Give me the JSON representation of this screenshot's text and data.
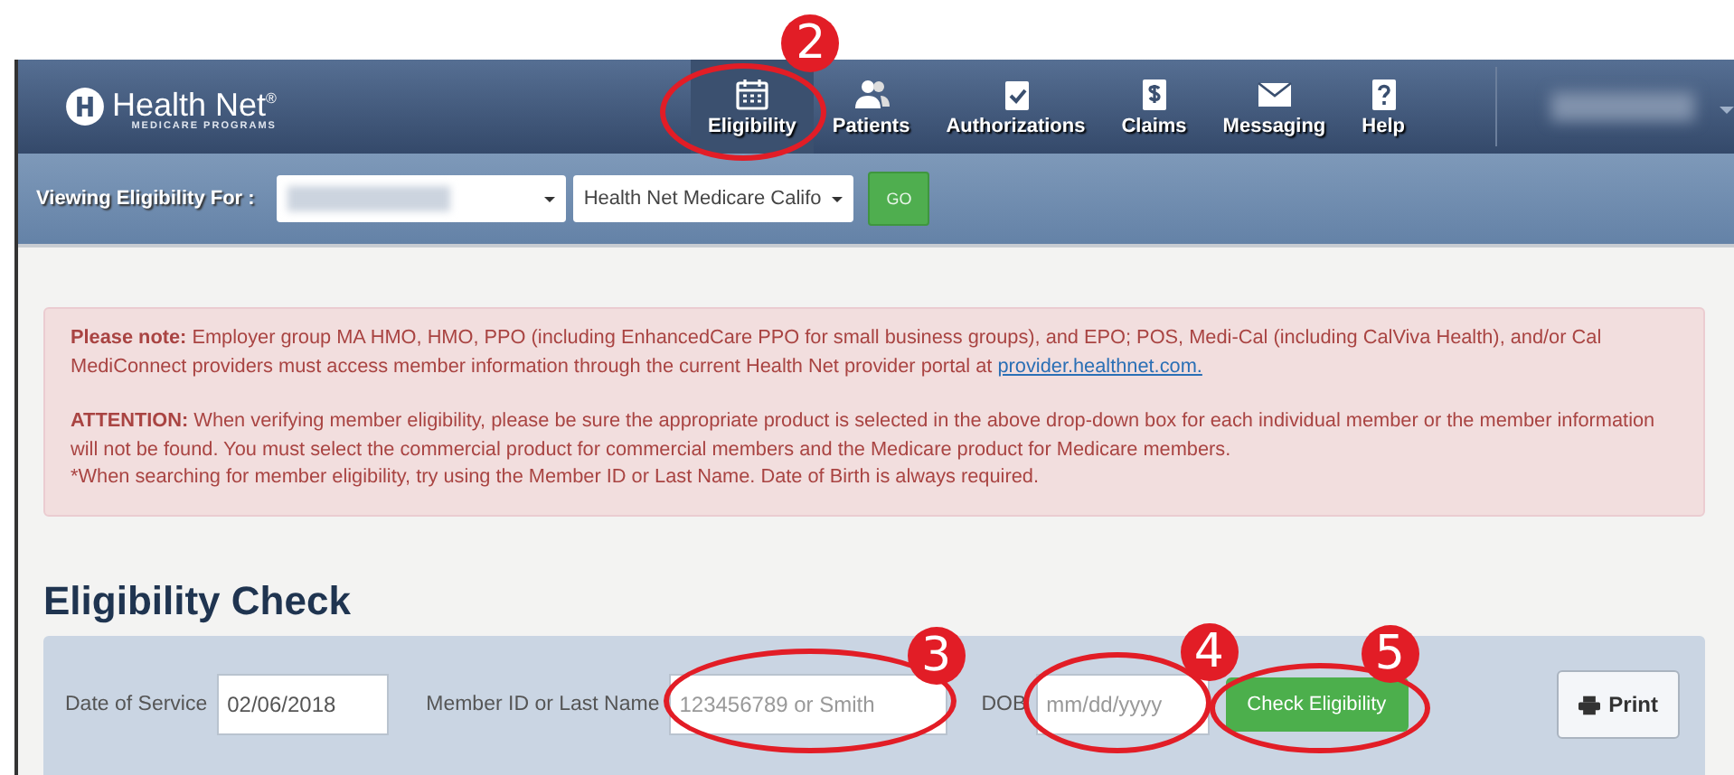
{
  "header": {
    "logo": {
      "name": "Health Net$^{®}$",
      "subtitle": "MEDICARE PROGRAMS"
    },
    "nav": [
      {
        "label": "Eligibility",
        "kind": "calendar",
        "selected": true,
        "callout": "2"
      },
      {
        "label": "Patients",
        "kind": "people",
        "selected": false
      },
      {
        "label": "Authorizations",
        "kind": "clipboard",
        "selected": false
      },
      {
        "label": "Claims",
        "kind": "dollar",
        "selected": false
      },
      {
        "label": "Messaging",
        "kind": "envelope",
        "selected": false
      },
      {
        "label": "Help",
        "kind": "question",
        "selected": false
      }
    ]
  },
  "toolbar": {
    "label": "Viewing Eligibility For :",
    "product_select": {
      "value": "Health Net Medicare Califo"
    },
    "go_button": "GO"
  },
  "notice": {
    "note": "**Please note:** Employer group MA HMO, HMO, PPO (including EnhancedCare PPO for small business groups), and EPO; POS, Medi-Cal (including CalViva Health), and/or Cal MediConnect providers must access member information through the current Health Net provider portal at",
    "link": "provider.healthnet.com.",
    "attention": "**ATTENTION:** When verifying member eligibility, please be sure the appropriate product is selected in the above drop-down box for each individual member or the member information will not be found. You must select the commercial product for commercial members and the Medicare product for Medicare members.",
    "hint": "*When searching for member eligibility, try using the Member ID or Last Name. Date of Birth is always required."
  },
  "eligibility_check": {
    "title": "Eligibility Check",
    "fields": [
      {
        "label": "Date of Service",
        "value": "02/06/2018"
      },
      {
        "label": "Member ID or Last Name",
        "placeholder": "123456789 or Smith",
        "callout": "3"
      },
      {
        "label": "DOB",
        "placeholder": "mm/dd/yyyy",
        "callout": "4"
      }
    ],
    "check_button": {
      "label": "Check Eligibility",
      "callout": "5"
    },
    "print_button": "Print"
  }
}
